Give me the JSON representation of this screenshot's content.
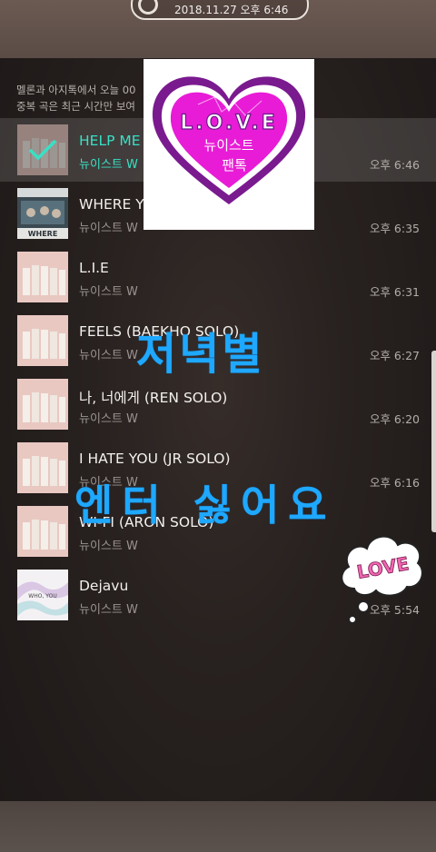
{
  "status_bar": {
    "datetime": "2018.11.27 오후 6:46"
  },
  "notice": {
    "line1": "멜론과 아지톡에서 오늘 00",
    "line2": "중복 곡은 최근 시간만 보여"
  },
  "songs": [
    {
      "title": "HELP ME",
      "artist": "뉴이스트 W",
      "time": "오후 6:46",
      "active": true
    },
    {
      "title": "WHERE Y",
      "artist": "뉴이스트 W",
      "time": "오후 6:35"
    },
    {
      "title": "L.I.E",
      "artist": "뉴이스트 W",
      "time": "오후 6:31"
    },
    {
      "title": "FEELS (BAEKHO SOLO)",
      "artist": "뉴이스트 W",
      "time": "오후 6:27"
    },
    {
      "title": "나, 너에게 (REN SOLO)",
      "artist": "뉴이스트 W",
      "time": "오후 6:20"
    },
    {
      "title": "I HATE YOU (JR SOLO)",
      "artist": "뉴이스트 W",
      "time": "오후 6:16"
    },
    {
      "title": "WI-FI (ARON SOLO)",
      "artist": "뉴이스트 W",
      "time": ""
    },
    {
      "title": "Dejavu",
      "artist": "뉴이스트 W",
      "time": "오후 5:54"
    }
  ],
  "album_labels": {
    "where": "WHERE",
    "dejavu": "WHO, YOU"
  },
  "stickers": {
    "heart_title": "L.O.V.E",
    "heart_sub1": "뉴이스트",
    "heart_sub2": "팬톡",
    "text1": "저녁별",
    "text2": "엔터 싫어요",
    "cloud": "LOVE"
  },
  "colors": {
    "accent": "#39e0c4",
    "sticker_blue": "#1ea8ff",
    "heart_magenta": "#e81cd6",
    "heart_purple": "#6a1a8a"
  }
}
